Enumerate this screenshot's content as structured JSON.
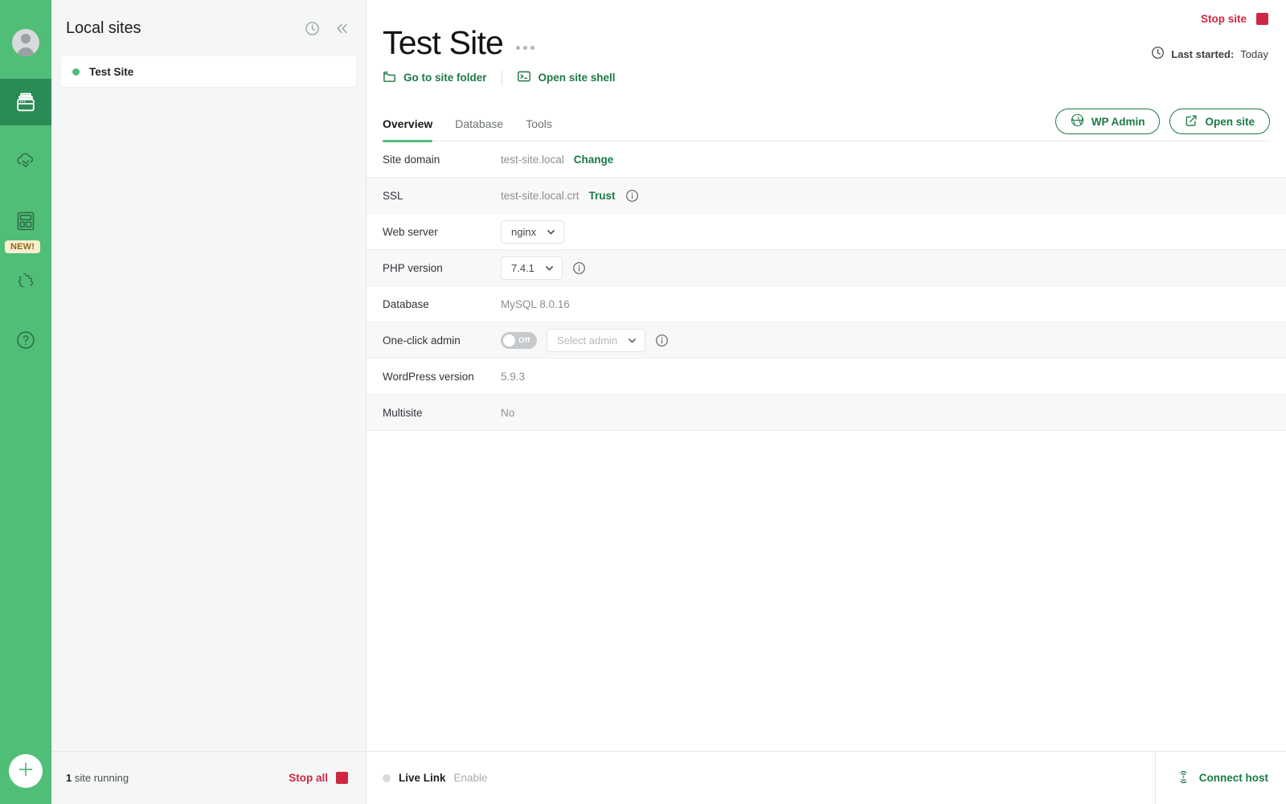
{
  "rail": {
    "items": [
      {
        "name": "avatar",
        "icon": "user-avatar-icon"
      },
      {
        "name": "sites",
        "icon": "sites-stack-icon",
        "active": true
      },
      {
        "name": "cloud-backups",
        "icon": "cloud-backup-icon",
        "active": false
      },
      {
        "name": "blueprints",
        "icon": "blueprint-icon",
        "active": false,
        "badge": "NEW!"
      },
      {
        "name": "add-ons",
        "icon": "puzzle-piece-icon",
        "active": false
      },
      {
        "name": "help",
        "icon": "question-circle-icon",
        "active": false
      }
    ],
    "add_site_label": "+",
    "badge_new": "NEW!"
  },
  "sites_panel": {
    "title": "Local sites",
    "history_icon": "clock-icon",
    "collapse_icon": "chevron-double-left-icon",
    "sites": [
      {
        "name": "Test Site",
        "status": "running"
      }
    ],
    "footer": {
      "running_count": "1",
      "running_text": "site running",
      "stop_all_label": "Stop all"
    }
  },
  "header": {
    "stop_site_label": "Stop site",
    "last_started_label": "Last started:",
    "last_started_value": "Today",
    "clock_icon": "clock-icon",
    "site_title": "Test Site",
    "more_icon": "ellipsis-icon",
    "links": [
      {
        "label": "Go to site folder",
        "icon": "folder-icon"
      },
      {
        "label": "Open site shell",
        "icon": "terminal-icon"
      }
    ]
  },
  "tabs": [
    {
      "label": "Overview",
      "active": true
    },
    {
      "label": "Database",
      "active": false
    },
    {
      "label": "Tools",
      "active": false
    }
  ],
  "tab_actions": [
    {
      "label": "WP Admin",
      "icon": "wordpress-icon"
    },
    {
      "label": "Open site",
      "icon": "external-link-icon"
    }
  ],
  "overview": {
    "rows": [
      {
        "label": "Site domain",
        "value": "test-site.local",
        "action": "Change",
        "type": "text-link"
      },
      {
        "label": "SSL",
        "value": "test-site.local.crt",
        "action": "Trust",
        "info": true,
        "type": "text-link-info"
      },
      {
        "label": "Web server",
        "value": "nginx",
        "type": "select"
      },
      {
        "label": "PHP version",
        "value": "7.4.1",
        "info": true,
        "type": "select-info"
      },
      {
        "label": "Database",
        "value": "MySQL 8.0.16",
        "type": "text"
      },
      {
        "label": "One-click admin",
        "toggle_state": "Off",
        "select_placeholder": "Select admin",
        "info": true,
        "type": "toggle-select-info"
      },
      {
        "label": "WordPress version",
        "value": "5.9.3",
        "type": "text"
      },
      {
        "label": "Multisite",
        "value": "No",
        "type": "text"
      }
    ]
  },
  "footer": {
    "live_link_label": "Live Link",
    "live_link_action": "Enable",
    "connect_host_label": "Connect host",
    "connect_host_icon": "connect-host-icon"
  },
  "colors": {
    "brand_green": "#51be78",
    "rail_active": "#2b8b56",
    "link_green": "#1b7a46",
    "danger_red": "#cf2741",
    "badge_bg": "#fbefd0",
    "badge_text": "#8a6b18"
  }
}
